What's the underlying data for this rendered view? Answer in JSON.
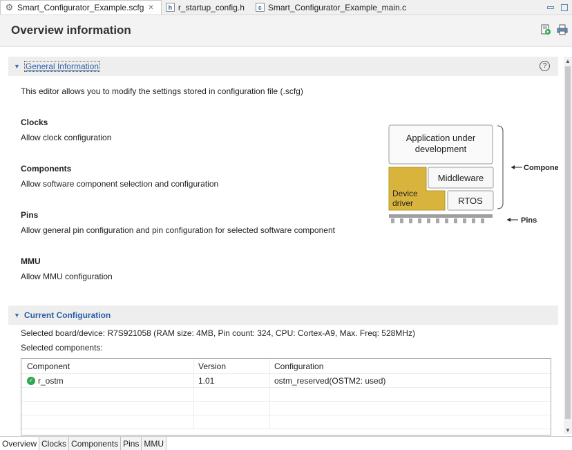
{
  "tabs": [
    {
      "label": "Smart_Configurator_Example.scfg",
      "icon": "gear-icon",
      "active": true,
      "closable": true
    },
    {
      "label": "r_startup_config.h",
      "icon": "h-file-icon",
      "badge": "h",
      "active": false
    },
    {
      "label": "Smart_Configurator_Example_main.c",
      "icon": "c-file-icon",
      "badge": "c",
      "active": false
    }
  ],
  "close_glyph": "✕",
  "header": {
    "title": "Overview information"
  },
  "general": {
    "title": "General Information",
    "intro": "This editor allows you to modify the settings stored in configuration file (.scfg)",
    "items": [
      {
        "heading": "Clocks",
        "text": "Allow clock configuration"
      },
      {
        "heading": "Components",
        "text": "Allow software component selection and configuration"
      },
      {
        "heading": "Pins",
        "text": "Allow general pin configuration and pin configuration for selected software component"
      },
      {
        "heading": "MMU",
        "text": "Allow MMU configuration"
      }
    ]
  },
  "diagram": {
    "app_line1": "Application under",
    "app_line2": "development",
    "middleware": "Middleware",
    "device_line1": "Device",
    "device_line2": "driver",
    "rtos": "RTOS",
    "components_label": "Compone",
    "pins_label": "Pins"
  },
  "current": {
    "title": "Current Configuration",
    "board_label": "Selected board/device:",
    "board_value": "R7S921058 (RAM size: 4MB, Pin count: 324, CPU: Cortex-A9, Max. Freq: 528MHz)",
    "components_label": "Selected components:",
    "columns": [
      "Component",
      "Version",
      "Configuration"
    ],
    "rows": [
      {
        "component": "r_ostm",
        "version": "1.01",
        "configuration": "ostm_reserved(OSTM2: used)",
        "status": "ok"
      }
    ]
  },
  "bottom_tabs": [
    "Overview",
    "Clocks",
    "Components",
    "Pins",
    "MMU"
  ],
  "colors": {
    "accent": "#2a5ea8",
    "ok": "#2fa84f",
    "device_driver": "#d9b43c"
  }
}
